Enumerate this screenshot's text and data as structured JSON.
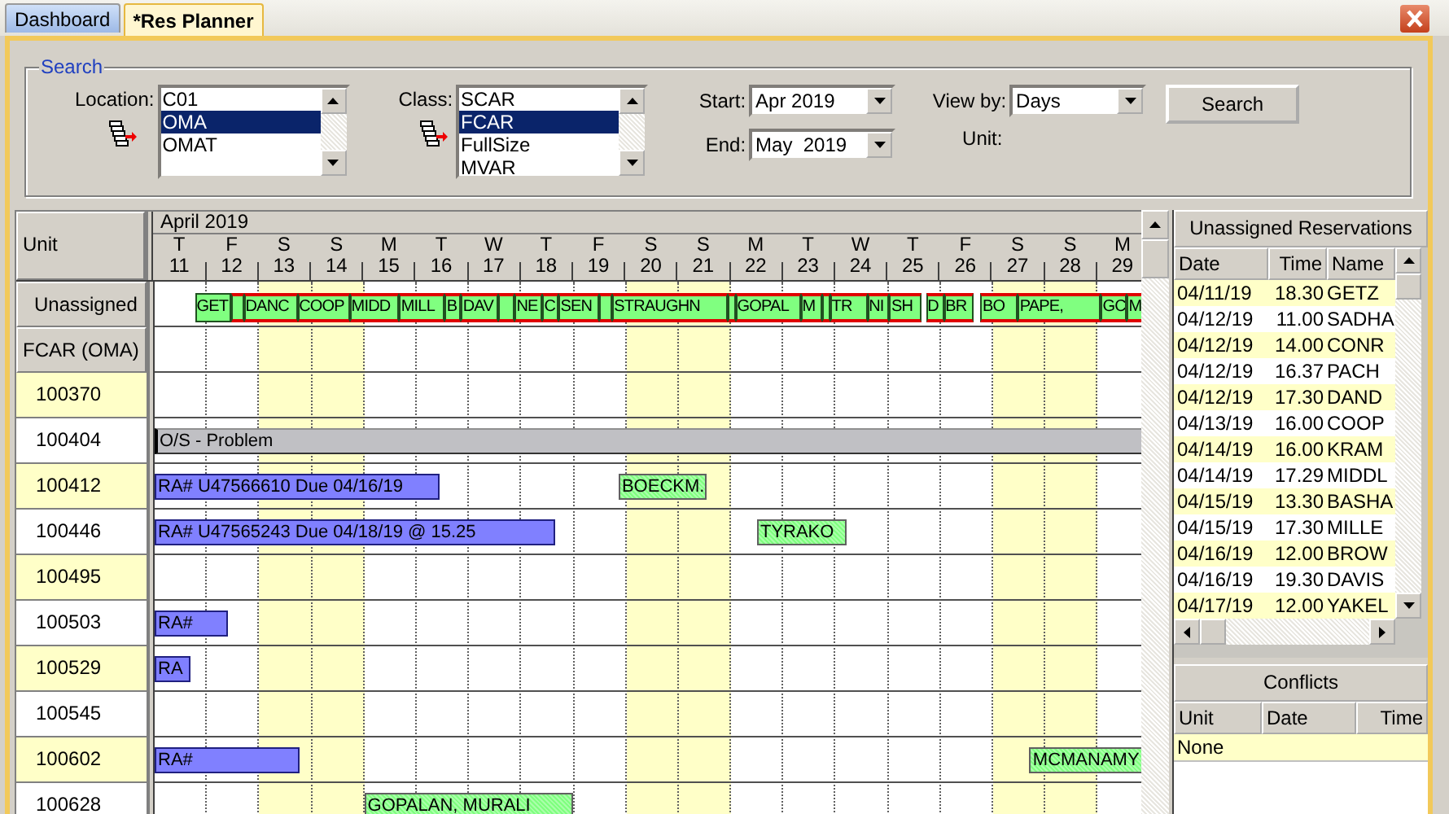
{
  "tabs": [
    {
      "label": "Dashboard",
      "selected": false
    },
    {
      "label": "*Res Planner",
      "selected": true
    }
  ],
  "search": {
    "title": "Search",
    "location": {
      "label": "Location:",
      "items": [
        {
          "text": "C01",
          "selected": false
        },
        {
          "text": "OMA",
          "selected": true
        },
        {
          "text": "OMAT",
          "selected": false
        }
      ]
    },
    "class": {
      "label": "Class:",
      "items": [
        {
          "text": "SCAR",
          "selected": false
        },
        {
          "text": "FCAR",
          "selected": true
        },
        {
          "text": "FullSize",
          "selected": false
        },
        {
          "text": "MVAR",
          "selected": false
        }
      ]
    },
    "start": {
      "label": "Start:",
      "value": "Apr 2019"
    },
    "end": {
      "label": "End:",
      "value": "May  2019"
    },
    "view_by": {
      "label": "View by:",
      "value": "Days"
    },
    "unit_label": "Unit:",
    "button": "Search"
  },
  "planner": {
    "unit_header": "Unit",
    "month": "April  2019",
    "days": [
      {
        "letter": "T",
        "date": "11",
        "weekend": false
      },
      {
        "letter": "F",
        "date": "12",
        "weekend": false
      },
      {
        "letter": "S",
        "date": "13",
        "weekend": true
      },
      {
        "letter": "S",
        "date": "14",
        "weekend": true
      },
      {
        "letter": "M",
        "date": "15",
        "weekend": false
      },
      {
        "letter": "T",
        "date": "16",
        "weekend": false
      },
      {
        "letter": "W",
        "date": "17",
        "weekend": false
      },
      {
        "letter": "T",
        "date": "18",
        "weekend": false
      },
      {
        "letter": "F",
        "date": "19",
        "weekend": false
      },
      {
        "letter": "S",
        "date": "20",
        "weekend": true
      },
      {
        "letter": "S",
        "date": "21",
        "weekend": true
      },
      {
        "letter": "M",
        "date": "22",
        "weekend": false
      },
      {
        "letter": "T",
        "date": "23",
        "weekend": false
      },
      {
        "letter": "W",
        "date": "24",
        "weekend": false
      },
      {
        "letter": "T",
        "date": "25",
        "weekend": false
      },
      {
        "letter": "F",
        "date": "26",
        "weekend": false
      },
      {
        "letter": "S",
        "date": "27",
        "weekend": true
      },
      {
        "letter": "S",
        "date": "28",
        "weekend": true
      },
      {
        "letter": "M",
        "date": "29",
        "weekend": false
      }
    ],
    "rows": [
      {
        "kind": "group",
        "label": "Unassigned",
        "bars": [
          {
            "kind": "unassigned",
            "text": "GET",
            "conflict": false
          },
          {
            "kind": "unassigned",
            "conflict": true
          },
          {
            "kind": "unassigned",
            "text": "DANC",
            "conflict": true
          },
          {
            "kind": "unassigned",
            "text": "COOP",
            "conflict": true
          },
          {
            "kind": "unassigned",
            "text": "MIDD",
            "conflict": true
          },
          {
            "kind": "unassigned",
            "text": "MILL",
            "conflict": true
          },
          {
            "kind": "unassigned",
            "text": "B",
            "conflict": true
          },
          {
            "kind": "unassigned",
            "text": "DAV",
            "conflict": true
          },
          {
            "kind": "unassigned",
            "conflict": true
          },
          {
            "kind": "unassigned",
            "text": "NE",
            "conflict": true
          },
          {
            "kind": "unassigned",
            "text": "C",
            "conflict": true
          },
          {
            "kind": "unassigned",
            "text": "SEN",
            "conflict": true
          },
          {
            "kind": "unassigned",
            "conflict": true
          },
          {
            "kind": "unassigned",
            "text": "STRAUGHN",
            "conflict": true
          },
          {
            "kind": "unassigned",
            "conflict": true
          },
          {
            "kind": "unassigned",
            "text": "GOPAL",
            "conflict": true
          },
          {
            "kind": "unassigned",
            "text": "M",
            "conflict": true
          },
          {
            "kind": "unassigned",
            "conflict": true
          },
          {
            "kind": "unassigned",
            "text": "TR",
            "conflict": true
          },
          {
            "kind": "unassigned",
            "text": "NI",
            "conflict": true
          },
          {
            "kind": "unassigned",
            "text": "SH",
            "conflict": true
          },
          {
            "kind": "unassigned",
            "text": "D",
            "conflict": true
          },
          {
            "kind": "unassigned",
            "text": "BR",
            "conflict": true
          },
          {
            "kind": "unassigned",
            "text": "BO",
            "conflict": true
          },
          {
            "kind": "unassigned",
            "text": "PAPE,",
            "conflict": true
          },
          {
            "kind": "unassigned",
            "text": "GC",
            "conflict": true
          },
          {
            "kind": "unassigned",
            "text": "M",
            "conflict": true
          }
        ]
      },
      {
        "kind": "group",
        "label": "FCAR (OMA)"
      },
      {
        "kind": "unit",
        "label": "100370"
      },
      {
        "kind": "unit",
        "label": "100404",
        "bars": [
          {
            "kind": "out_of_service",
            "text": "O/S - Problem"
          }
        ]
      },
      {
        "kind": "unit",
        "label": "100412",
        "bars": [
          {
            "kind": "rental",
            "text": "RA# U47566610  Due 04/16/19"
          },
          {
            "kind": "reservation",
            "text": "BOECKM."
          }
        ]
      },
      {
        "kind": "unit",
        "label": "100446",
        "bars": [
          {
            "kind": "rental",
            "text": "RA# U47565243  Due 04/18/19 @ 15.25"
          },
          {
            "kind": "reservation",
            "text": "TYRAKO"
          }
        ]
      },
      {
        "kind": "unit",
        "label": "100495"
      },
      {
        "kind": "unit",
        "label": "100503",
        "bars": [
          {
            "kind": "rental",
            "text": "RA#"
          }
        ]
      },
      {
        "kind": "unit",
        "label": "100529",
        "bars": [
          {
            "kind": "rental",
            "text": "RA"
          }
        ]
      },
      {
        "kind": "unit",
        "label": "100545"
      },
      {
        "kind": "unit",
        "label": "100602",
        "bars": [
          {
            "kind": "rental",
            "text": "RA#"
          },
          {
            "kind": "reservation",
            "text": "MCMANAMY"
          }
        ]
      },
      {
        "kind": "unit",
        "label": "100628",
        "bars": [
          {
            "kind": "reservation",
            "text": "GOPALAN, MURALI"
          }
        ]
      }
    ]
  },
  "unassigned": {
    "title": "Unassigned Reservations",
    "columns": [
      "Date",
      "Time",
      "Name"
    ],
    "rows": [
      {
        "date": "04/11/19",
        "time": "18.30",
        "name": "GETZ"
      },
      {
        "date": "04/12/19",
        "time": "11.00",
        "name": "SADHA"
      },
      {
        "date": "04/12/19",
        "time": "14.00",
        "name": "CONR"
      },
      {
        "date": "04/12/19",
        "time": "16.37",
        "name": "PACH"
      },
      {
        "date": "04/12/19",
        "time": "17.30",
        "name": "DAND"
      },
      {
        "date": "04/13/19",
        "time": "16.00",
        "name": "COOP"
      },
      {
        "date": "04/14/19",
        "time": "16.00",
        "name": "KRAM"
      },
      {
        "date": "04/14/19",
        "time": "17.29",
        "name": "MIDDL"
      },
      {
        "date": "04/15/19",
        "time": "13.30",
        "name": "BASHA"
      },
      {
        "date": "04/15/19",
        "time": "17.30",
        "name": "MILLE"
      },
      {
        "date": "04/16/19",
        "time": "12.00",
        "name": "BROW"
      },
      {
        "date": "04/16/19",
        "time": "19.30",
        "name": "DAVIS"
      },
      {
        "date": "04/17/19",
        "time": "12.00",
        "name": "YAKEL"
      }
    ]
  },
  "conflicts": {
    "title": "Conflicts",
    "columns": [
      "Unit",
      "Date",
      "Time"
    ],
    "rows": [
      {
        "text": "None"
      }
    ]
  }
}
